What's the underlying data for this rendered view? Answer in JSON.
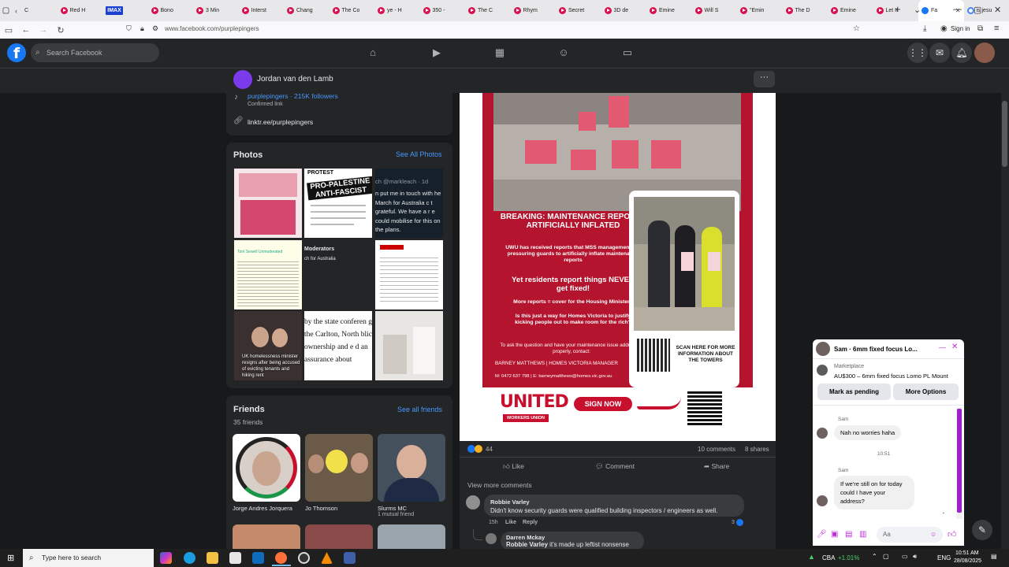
{
  "browser": {
    "tabs": [
      {
        "label": "C",
        "icon": "back-icon"
      },
      {
        "label": "Red H",
        "icon": "youtube-icon"
      },
      {
        "label": "IMAX",
        "icon": "imax-icon"
      },
      {
        "label": "Bono",
        "icon": "youtube-icon"
      },
      {
        "label": "3 Min",
        "icon": "youtube-icon"
      },
      {
        "label": "Interst",
        "icon": "youtube-icon"
      },
      {
        "label": "Chang",
        "icon": "youtube-icon"
      },
      {
        "label": "The Co",
        "icon": "youtube-icon"
      },
      {
        "label": "ye - H",
        "icon": "youtube-icon"
      },
      {
        "label": "350 -",
        "icon": "youtube-icon"
      },
      {
        "label": "The C",
        "icon": "youtube-icon"
      },
      {
        "label": "Rhym",
        "icon": "youtube-icon"
      },
      {
        "label": "Secret",
        "icon": "youtube-icon"
      },
      {
        "label": "3D de",
        "icon": "youtube-icon"
      },
      {
        "label": "Emine",
        "icon": "youtube-icon"
      },
      {
        "label": "Will S",
        "icon": "youtube-icon"
      },
      {
        "label": "\"Emin",
        "icon": "youtube-icon"
      },
      {
        "label": "The D",
        "icon": "youtube-icon"
      },
      {
        "label": "Emine",
        "icon": "youtube-icon"
      },
      {
        "label": "Let It",
        "icon": "youtube-icon"
      },
      {
        "label": "Fa",
        "icon": "facebook-icon",
        "active": true
      },
      {
        "label": "is jesu",
        "icon": "google-icon"
      }
    ],
    "url": "www.facebook.com/purplepingers",
    "sign_in": "Sign in"
  },
  "facebook": {
    "search_placeholder": "Search Facebook",
    "page_name": "Jordan van den Lamb",
    "more_button": "···"
  },
  "intro": {
    "tiktok": "purplepingers · 215K followers",
    "tiktok_sub": "Confirmed link",
    "linktree": "linktr.ee/purplepingers"
  },
  "photos": {
    "title": "Photos",
    "see_all": "See All Photos",
    "tiles": [
      {
        "caption": ""
      },
      {
        "caption": "PRO-PALESTINE ANTI-FASCIST",
        "top": "PROTEST"
      },
      {
        "caption": "ch @markleach · 1d",
        "body": "n put me in touch with he March for Australia c t grateful. We have a r e could mobilise for this on the plans."
      },
      {
        "caption": "Tom Sewell Unmoderated"
      },
      {
        "caption": "Moderators",
        "body": "ch for Australia"
      },
      {
        "caption": ""
      },
      {
        "caption": "UK homelessness minister resigns after being accused of evicting tenants and hiking rent"
      },
      {
        "caption": "by the state conferen g the Carlton, North blic ownership and e d an assurance about"
      },
      {
        "caption": ""
      }
    ]
  },
  "friends": {
    "title": "Friends",
    "count": "35 friends",
    "see_all": "See all friends",
    "list": [
      {
        "name": "Jorge Andres Jorquera",
        "mutual": ""
      },
      {
        "name": "Jo Thomson",
        "mutual": ""
      },
      {
        "name": "Slurms MC",
        "mutual": "1 mutual friend"
      }
    ]
  },
  "poster": {
    "headline": "BREAKING: MAINTENANCE REPORTS ARTIFICIALLY INFLATED",
    "para1": "UWU has received reports that MSS management are pressuring guards to artificially inflate maintenance reports",
    "para2": "Yet residents report things NEVER get fixed!",
    "para3": "More reports = cover for the Housing Minister?",
    "para4": "Is this just a way for Homes Victoria to justify kicking people out to make room for the rich?",
    "contact_intro": "To ask the question and have your maintenance issue addressed properly, contact:",
    "contact_name": "BARNEY MATTHEWS | HOMES VICTORIA MANAGER",
    "contact_details": "M: 0472 637 798 | E: barneymatthews@homes.vic.gov.au",
    "scan_text": "SCAN HERE FOR MORE INFORMATION ABOUT THE TOWERS",
    "union": "UNITED",
    "union_sub": "WORKERS UNION",
    "sign_now": "SIGN NOW"
  },
  "post_stats": {
    "reactions": "44",
    "comments": "10 comments",
    "shares": "8 shares",
    "like": "Like",
    "comment": "Comment",
    "share": "Share",
    "view_more": "View more comments"
  },
  "comments": [
    {
      "author": "Robbie Varley",
      "text": "Didn't know security guards were qualified building inspectors / engineers as well.",
      "time": "15h",
      "like": "Like",
      "reply": "Reply",
      "reacts": "3"
    },
    {
      "author": "Darren Mckay",
      "mention": "Robbie Varley",
      "text": "it's made up leftist nonsense"
    }
  ],
  "chat": {
    "title": "Sam · 6mm fixed focus Lo...",
    "marketplace": "Marketplace",
    "listing": "AU$300 – 6mm fixed focus Lomo PL Mount",
    "mark_pending": "Mark as pending",
    "more_options": "More Options",
    "messages": [
      {
        "sender": "Sam",
        "text": "Nah no worries haha"
      },
      {
        "time": "10:51"
      },
      {
        "sender": "Sam",
        "text": "If we're still on for today could I have your address?"
      }
    ],
    "input_placeholder": "Aa"
  },
  "taskbar": {
    "search": "Type here to search",
    "ticker": "CBA",
    "ticker_change": "+1.01%",
    "lang": "ENG",
    "time": "10:51 AM",
    "date": "28/08/2025"
  },
  "colors": {
    "fb_blue": "#1877f2",
    "uwu_red": "#c8102e",
    "ticker_green": "#4ccf6b"
  }
}
